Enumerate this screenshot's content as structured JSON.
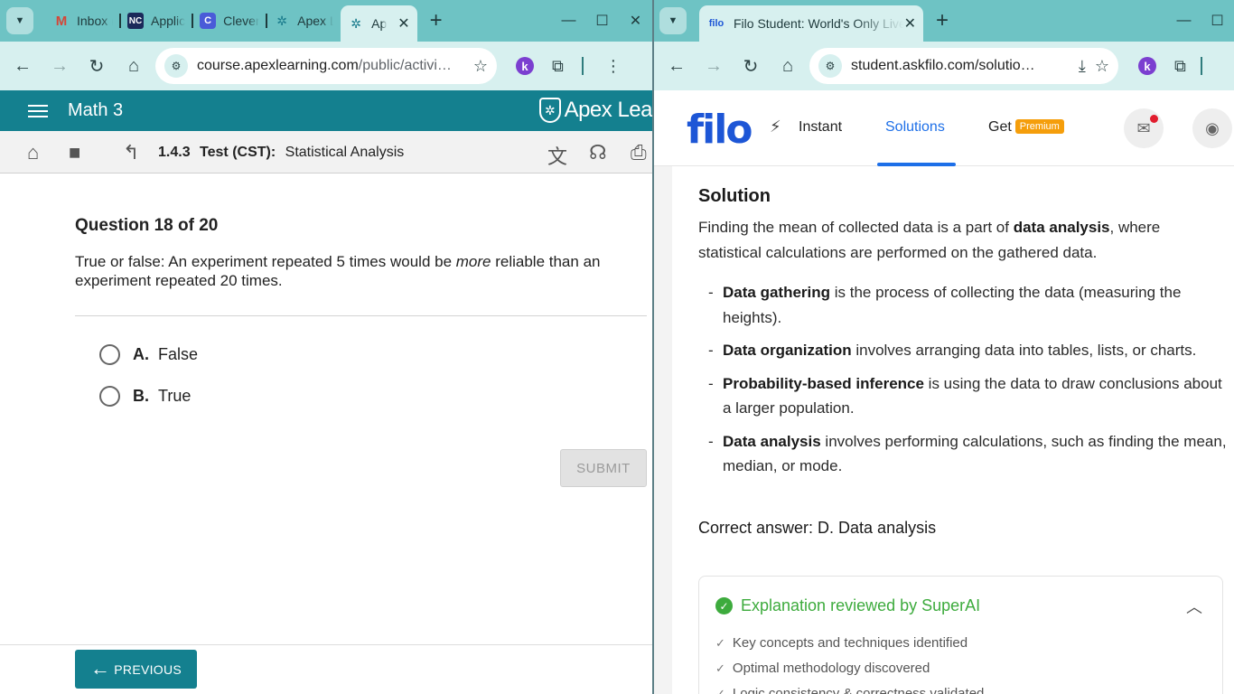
{
  "left_browser": {
    "tabs": [
      {
        "title": "Inbox (",
        "favicon": "gmail-icon"
      },
      {
        "title": "Applic",
        "favicon": "nc-icon"
      },
      {
        "title": "Clever",
        "favicon": "clever-icon"
      },
      {
        "title": "Apex L",
        "favicon": "apex-icon"
      },
      {
        "title": "Ap",
        "favicon": "apex-icon",
        "active": true
      }
    ],
    "url_host": "course.apexlearning.com",
    "url_path": "/public/activi…"
  },
  "apex": {
    "course_title": "Math 3",
    "logo_text": "Apex Lea",
    "breadcrumb_number": "1.4.3",
    "breadcrumb_type": "Test (CST):",
    "breadcrumb_title": "Statistical Analysis",
    "question_heading": "Question 18 of 20",
    "question_text_before": "True or false: An experiment repeated 5 times would be ",
    "question_text_emph": "more",
    "question_text_after": " reliable than an experiment repeated 20 times.",
    "options": [
      {
        "letter": "A.",
        "text": "False"
      },
      {
        "letter": "B.",
        "text": "True"
      }
    ],
    "submit_label": "SUBMIT",
    "previous_label": "PREVIOUS",
    "brand_color": "#14808f"
  },
  "right_browser": {
    "tab_title": "Filo Student: World's Only Live I",
    "url_text": "student.askfilo.com/solutio…"
  },
  "filo": {
    "logo": "filo",
    "nav": {
      "instant": "Instant",
      "solutions": "Solutions",
      "get": "Get",
      "premium": "Premium"
    },
    "solution_heading": "Solution",
    "intro_before": "Finding the mean of collected data is a part of ",
    "intro_bold": "data analysis",
    "intro_after": ", where statistical calculations are performed on the gathered data.",
    "bullets": [
      {
        "term": "Data gathering",
        "rest": " is the process of collecting the data (measuring the heights)."
      },
      {
        "term": "Data organization",
        "rest": " involves arranging data into tables, lists, or charts."
      },
      {
        "term": "Probability-based inference",
        "rest": " is using the data to draw conclusions about a larger population."
      },
      {
        "term": "Data analysis",
        "rest": " involves performing calculations, such as finding the mean, median, or mode."
      }
    ],
    "correct_answer": "Correct answer: D. Data analysis",
    "explanation_heading": "Explanation reviewed by SuperAI",
    "explanation_checks": [
      "Key concepts and techniques identified",
      "Optimal methodology discovered",
      "Logic consistency & correctness validated"
    ],
    "accent_color": "#1d6fe8",
    "success_color": "#3dab3d"
  }
}
